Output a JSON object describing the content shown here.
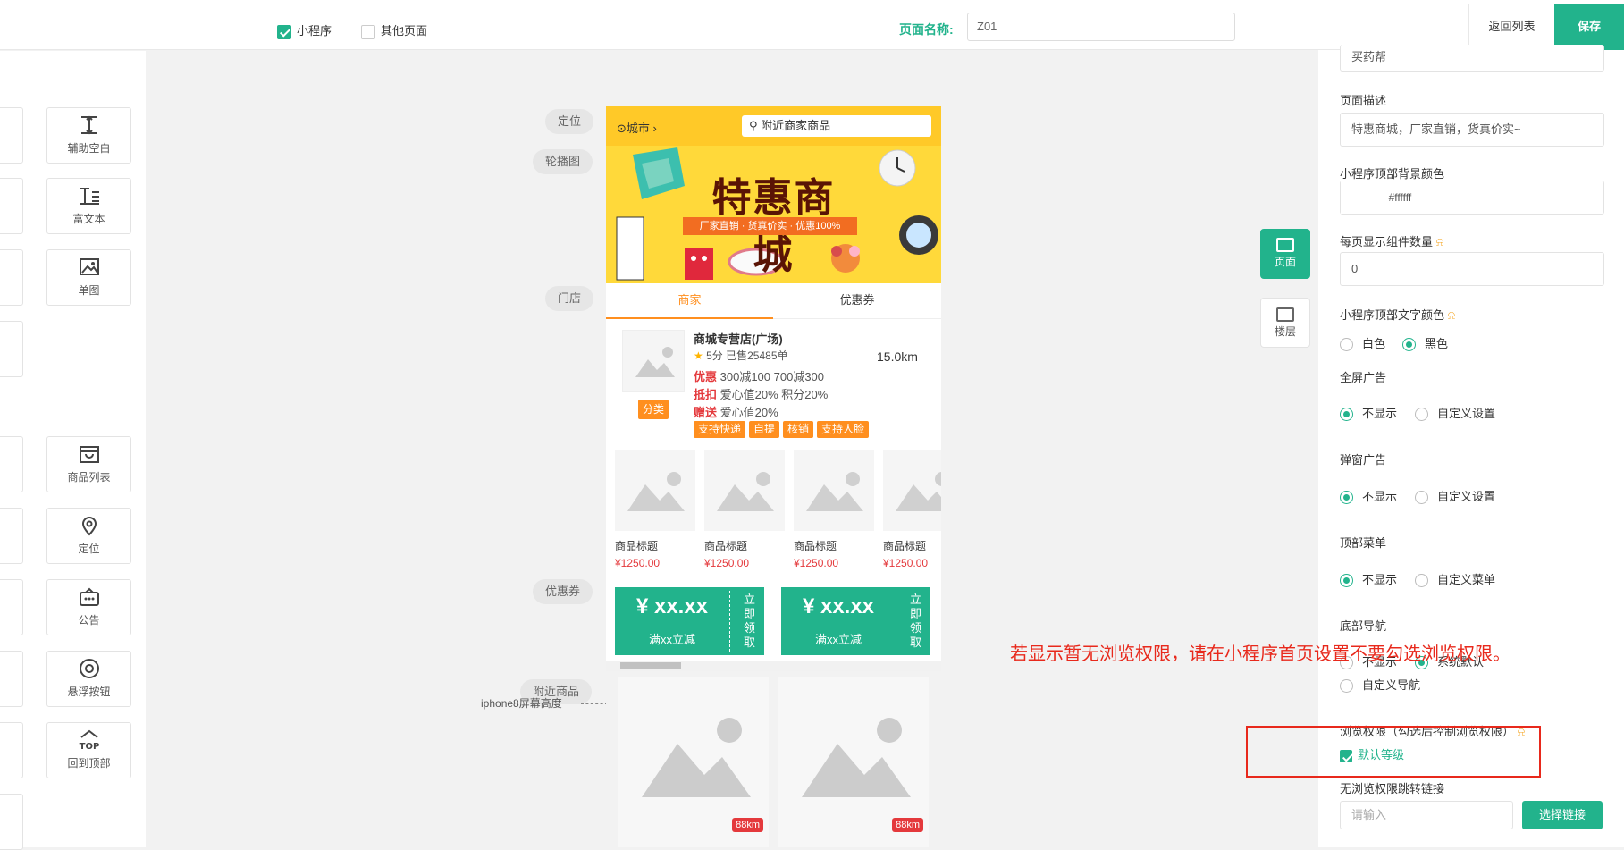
{
  "topbar": {
    "miniprogram_label": "小程序",
    "other_pages_label": "其他页面",
    "page_name_label": "页面名称:",
    "page_name_value": "Z01",
    "back_label": "返回列表",
    "save_label": "保存"
  },
  "components": [
    {
      "label": "辅助空白",
      "icon": "blank-icon"
    },
    {
      "label": "富文本",
      "icon": "rich-text-icon"
    },
    {
      "label": "单图",
      "icon": "image-icon"
    },
    {
      "label": "商品列表",
      "icon": "product-list-icon"
    },
    {
      "label": "定位",
      "icon": "location-icon"
    },
    {
      "label": "公告",
      "icon": "notice-icon"
    },
    {
      "label": "悬浮按钮",
      "icon": "float-button-icon"
    },
    {
      "label": "回到顶部",
      "icon": "back-to-top-icon"
    }
  ],
  "canvas_labels": {
    "location": "定位",
    "carousel": "轮播图",
    "store": "门店",
    "coupon": "优惠券",
    "nearby": "附近商品",
    "iphone_hint": "iphone8屏幕高度"
  },
  "phone": {
    "city": "城市",
    "search_placeholder": "附近商家商品",
    "banner_title": "特惠商城",
    "banner_sub": "厂家直销 · 货真价实 · 优惠100%",
    "tabs": [
      "商家",
      "优惠券"
    ],
    "store": {
      "name": "商城专营店(广场)",
      "rating": "5分",
      "sold": "已售25485单",
      "distance": "15.0km",
      "category": "分类",
      "promos": [
        {
          "label": "优惠",
          "text": "300减100   700减300"
        },
        {
          "label": "抵扣",
          "text": "爱心值20%   积分20%"
        },
        {
          "label": "赠送",
          "text": "爱心值20%"
        }
      ],
      "tags": [
        "支持快递",
        "自提",
        "核销",
        "支持人脸"
      ]
    },
    "products": [
      {
        "name": "商品标题",
        "price": "¥1250.00"
      },
      {
        "name": "商品标题",
        "price": "¥1250.00"
      },
      {
        "name": "商品标题",
        "price": "¥1250.00"
      },
      {
        "name": "商品标题",
        "price": "¥1250.00"
      }
    ],
    "coupons": [
      {
        "amount": "¥ xx.xx",
        "cond": "满xx立减",
        "action": "立即领取"
      },
      {
        "amount": "¥ xx.xx",
        "cond": "满xx立减",
        "action": "立即领取"
      }
    ],
    "nearby": [
      {
        "distance": "88km"
      },
      {
        "distance": "88km"
      }
    ]
  },
  "side_buttons": [
    {
      "label": "页面",
      "active": true
    },
    {
      "label": "楼层",
      "active": false
    }
  ],
  "settings": {
    "title_value": "买药帮",
    "desc_label": "页面描述",
    "desc_value": "特惠商城，厂家直销，货真价实~",
    "bg_color_label": "小程序顶部背景颜色",
    "bg_color_value": "#ffffff",
    "per_page_label": "每页显示组件数量",
    "per_page_value": "0",
    "text_color_label": "小程序顶部文字颜色",
    "text_color_options": [
      "白色",
      "黑色"
    ],
    "fullscreen_ad_label": "全屏广告",
    "popup_ad_label": "弹窗广告",
    "ad_options": [
      "不显示",
      "自定义设置"
    ],
    "top_menu_label": "顶部菜单",
    "top_menu_options": [
      "不显示",
      "自定义菜单"
    ],
    "bottom_nav_label": "底部导航",
    "bottom_nav_options": [
      "不显示",
      "系统默认",
      "自定义导航"
    ],
    "permission_label": "浏览权限（勾选后控制浏览权限）",
    "permission_option": "默认等级",
    "redirect_label": "无浏览权限跳转链接",
    "redirect_placeholder": "请输入",
    "choose_link_label": "选择链接"
  },
  "annotation": {
    "text": "若显示暂无浏览权限，请在小程序首页设置不要勾选浏览权限。",
    "color": "#e8291c"
  },
  "colors": {
    "accent": "#22b38c",
    "orange": "#ff8f1f",
    "red": "#e4393c",
    "banner": "#ffd93a"
  }
}
